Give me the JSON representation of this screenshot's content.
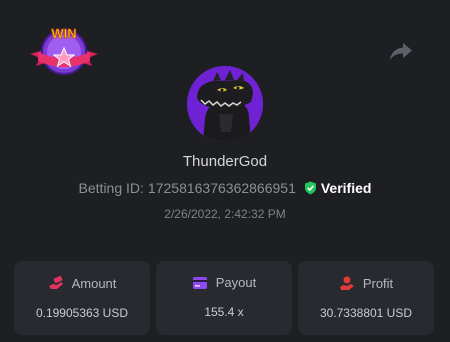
{
  "badge": {
    "text": "WIN"
  },
  "user": {
    "name": "ThunderGod",
    "betting_label": "Betting ID:",
    "betting_id": "1725816376362866951",
    "verified_label": "Verified",
    "timestamp": "2/26/2022, 2:42:32 PM"
  },
  "stats": [
    {
      "label": "Amount",
      "value": "0.19905363 USD",
      "icon": "money-hand-icon",
      "color": "#e0345f"
    },
    {
      "label": "Payout",
      "value": "155.4 x",
      "icon": "card-icon",
      "color": "#8d4af0"
    },
    {
      "label": "Profit",
      "value": "30.7338801 USD",
      "icon": "coin-hand-icon",
      "color": "#e23a3a"
    }
  ],
  "colors": {
    "verified": "#22c55e",
    "avatar_bg": "#6e22d3",
    "card_bg": "#292a2f"
  }
}
